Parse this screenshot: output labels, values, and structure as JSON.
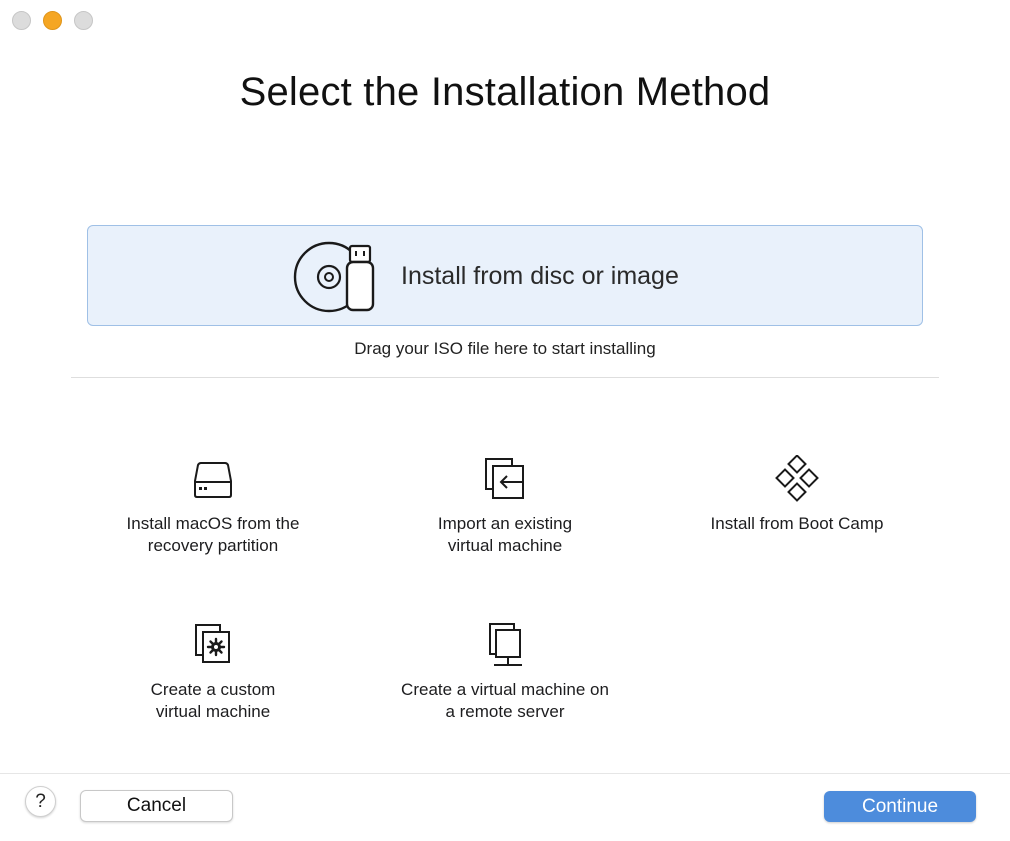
{
  "window": {
    "traffic_lights": [
      {
        "name": "close",
        "color": "#dcdcdc"
      },
      {
        "name": "minimize",
        "color": "#f5a623"
      },
      {
        "name": "zoom",
        "color": "#dcdcdc"
      }
    ]
  },
  "title": "Select the Installation Method",
  "dropzone": {
    "label": "Install from disc or image",
    "hint": "Drag your ISO file here to start installing",
    "icon": "disc-usb-icon",
    "background": "#e9f1fb",
    "border": "#9fc0e6"
  },
  "options": [
    {
      "label": "Install macOS from the\nrecovery partition",
      "icon": "hard-drive-icon"
    },
    {
      "label": "Import an existing\nvirtual machine",
      "icon": "import-vm-icon"
    },
    {
      "label": "Install from Boot Camp",
      "icon": "boot-camp-icon"
    },
    {
      "label": "Create a custom\nvirtual machine",
      "icon": "custom-vm-icon"
    },
    {
      "label": "Create a virtual machine on\na remote server",
      "icon": "remote-server-icon"
    }
  ],
  "footer": {
    "help_label": "?",
    "cancel_label": "Cancel",
    "continue_label": "Continue",
    "accent": "#4d8cdc"
  }
}
